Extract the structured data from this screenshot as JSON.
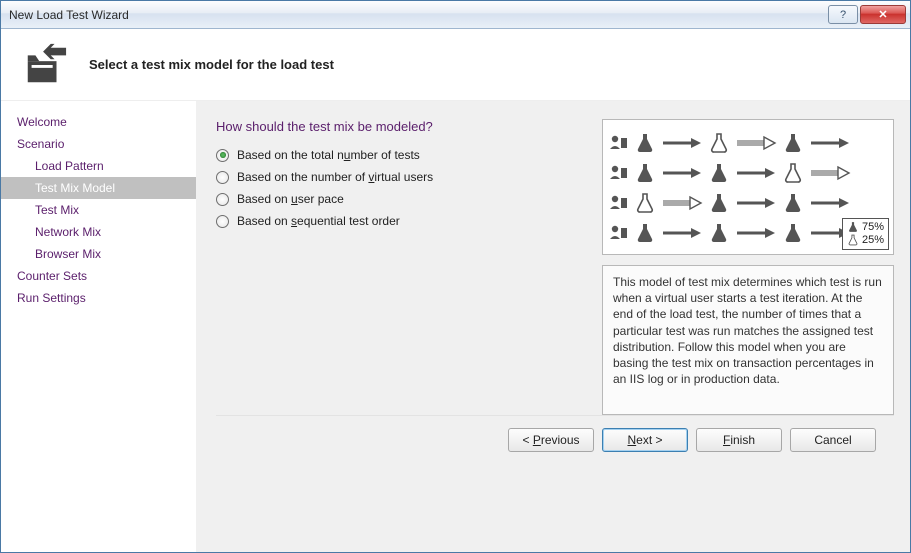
{
  "window": {
    "title": "New Load Test Wizard"
  },
  "header": {
    "title": "Select a test mix model for the load test"
  },
  "sidebar": {
    "items": [
      {
        "label": "Welcome",
        "indent": 0,
        "selected": false
      },
      {
        "label": "Scenario",
        "indent": 0,
        "selected": false
      },
      {
        "label": "Load Pattern",
        "indent": 1,
        "selected": false
      },
      {
        "label": "Test Mix Model",
        "indent": 1,
        "selected": true
      },
      {
        "label": "Test Mix",
        "indent": 1,
        "selected": false
      },
      {
        "label": "Network Mix",
        "indent": 1,
        "selected": false
      },
      {
        "label": "Browser Mix",
        "indent": 1,
        "selected": false
      },
      {
        "label": "Counter Sets",
        "indent": 0,
        "selected": false
      },
      {
        "label": "Run Settings",
        "indent": 0,
        "selected": false
      }
    ]
  },
  "content": {
    "question": "How should the test mix be modeled?",
    "options": [
      {
        "pre": "Based on the total n",
        "accel": "u",
        "post": "mber of tests",
        "checked": true
      },
      {
        "pre": "Based on the number of ",
        "accel": "v",
        "post": "irtual users",
        "checked": false
      },
      {
        "pre": "Based on ",
        "accel": "u",
        "post": "ser pace",
        "checked": false
      },
      {
        "pre": "Based on ",
        "accel": "s",
        "post": "equential test order",
        "checked": false
      }
    ],
    "percent1": "75%",
    "percent2": "25%",
    "description": "This model of test mix determines which test is run when a virtual user starts a test iteration. At the end of the load test, the number of times that a particular test was run matches the assigned test distribution. Follow this model when you are basing the test mix on transaction percentages in an IIS log or in production data."
  },
  "footer": {
    "prev_pre": "< ",
    "prev_accel": "P",
    "prev_post": "revious",
    "next_pre": "",
    "next_accel": "N",
    "next_post": "ext >",
    "finish_pre": "",
    "finish_accel": "F",
    "finish_post": "inish",
    "cancel": "Cancel"
  }
}
